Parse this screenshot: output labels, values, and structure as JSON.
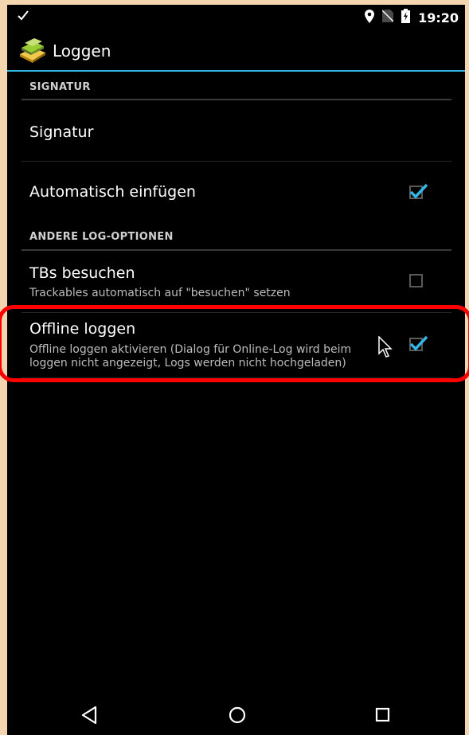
{
  "status_bar": {
    "time": "19:20"
  },
  "action_bar": {
    "title": "Loggen"
  },
  "sections": {
    "signatur": {
      "header": "SIGNATUR",
      "signatur_title": "Signatur",
      "auto_insert_title": "Automatisch einfügen",
      "auto_insert_checked": true
    },
    "other_options": {
      "header": "ANDERE LOG-OPTIONEN",
      "tbs_title": "TBs besuchen",
      "tbs_summary": "Trackables automatisch auf \"besuchen\" setzen",
      "tbs_checked": false,
      "offline_title": "Offline loggen",
      "offline_summary": "Offline loggen aktivieren (Dialog für Online-Log wird beim loggen nicht angezeigt, Logs werden nicht hochgeladen)",
      "offline_checked": true
    }
  },
  "colors": {
    "accent": "#33b5e5",
    "highlight": "#ff0000",
    "background": "#000000"
  },
  "icons": [
    "check-icon",
    "location-icon",
    "no-sim-icon",
    "battery-icon",
    "app-icon",
    "back-icon",
    "home-icon",
    "recents-icon",
    "mouse-cursor-icon"
  ]
}
